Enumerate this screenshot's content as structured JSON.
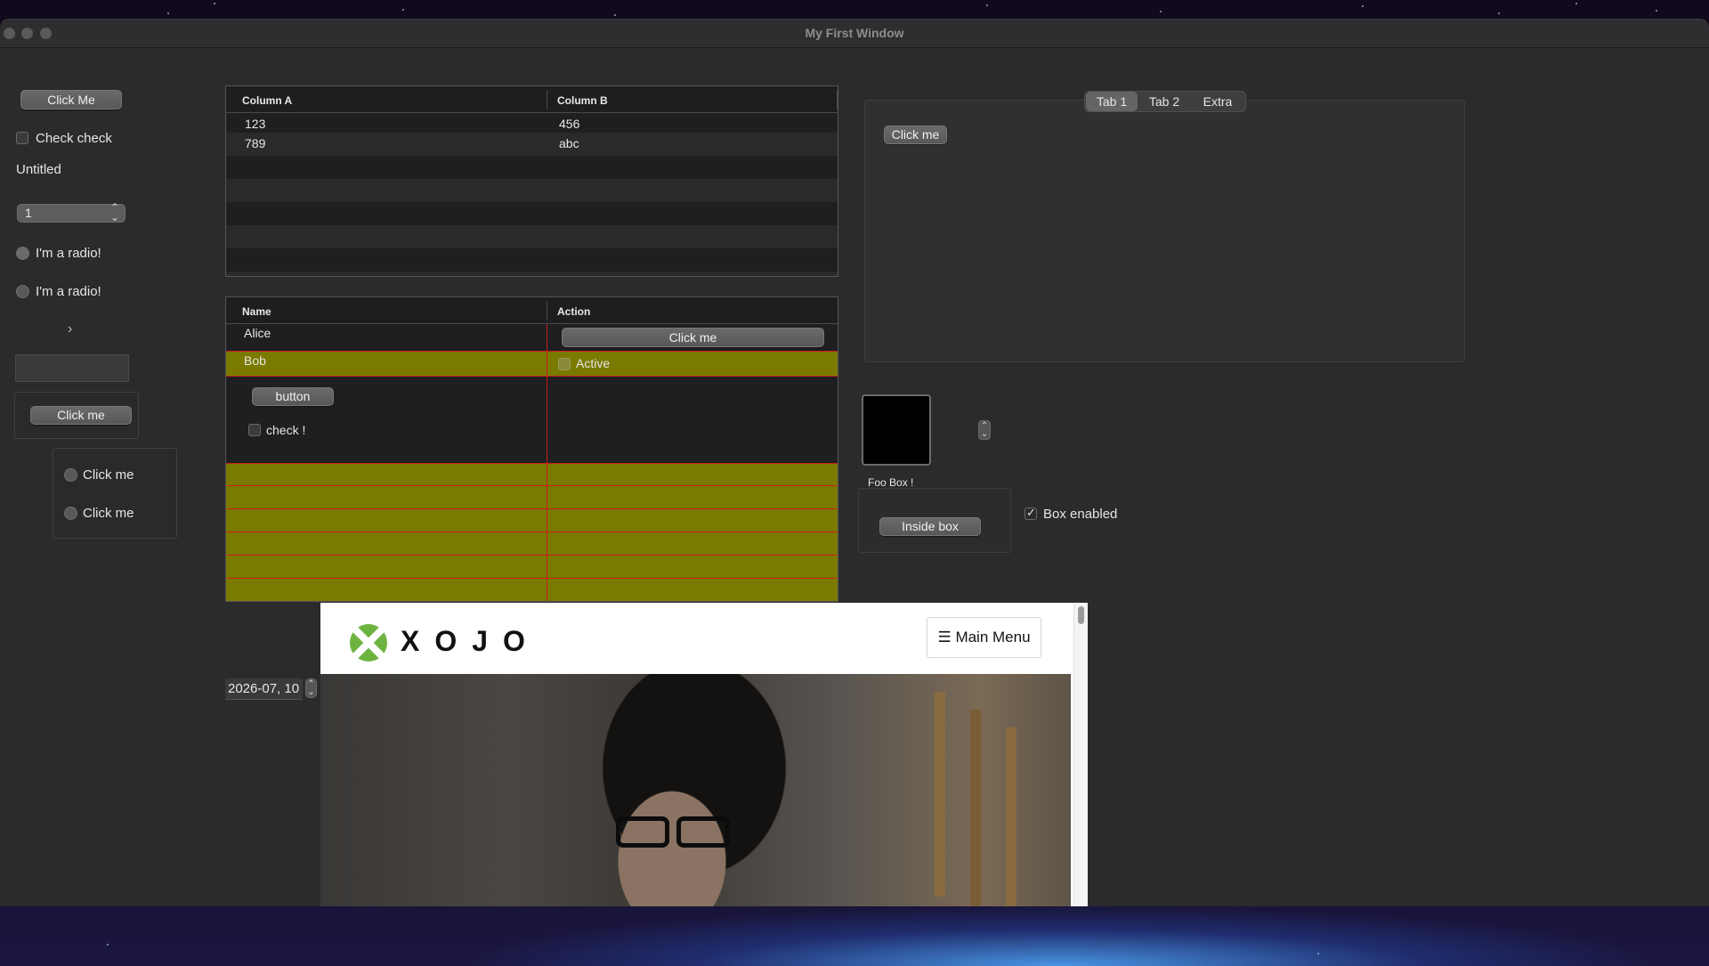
{
  "window": {
    "title": "My First Window"
  },
  "left": {
    "click_me_button": "Click Me",
    "check_label": "Check check",
    "untitled_label": "Untitled",
    "popup_value": "1",
    "radio1": "I'm a radio!",
    "radio2": "I'm a radio!",
    "disclosure": "›",
    "inner_button": "Click me",
    "group_radio1": "Click me",
    "group_radio2": "Click me"
  },
  "table1": {
    "columns": [
      "Column A",
      "Column B"
    ],
    "rows": [
      [
        "123",
        "456"
      ],
      [
        "789",
        "abc"
      ]
    ]
  },
  "table2": {
    "columns": [
      "Name",
      "Action"
    ],
    "rows": [
      {
        "name": "Alice",
        "action_button": "Click me"
      },
      {
        "name": "Bob",
        "action_checkbox": "Active"
      }
    ],
    "nested_button": "button",
    "nested_check": "check !"
  },
  "tabs": {
    "labels": [
      "Tab 1",
      "Tab 2",
      "Extra"
    ],
    "selected": "Tab 1",
    "content_button": "Click me"
  },
  "foo_box": {
    "title": "Foo Box !",
    "inside_button": "Inside box",
    "enable_checkbox": "Box enabled",
    "enabled": true
  },
  "date_field": {
    "value": "2026-07, 10"
  },
  "web": {
    "brand": "XOJO",
    "menu_button": "Main Menu"
  },
  "colors": {
    "window_bg": "#2b2b2d",
    "highlight_row": "#7a7a00",
    "grid_line": "#c81e1e",
    "xojo_green": "#6db33f"
  }
}
